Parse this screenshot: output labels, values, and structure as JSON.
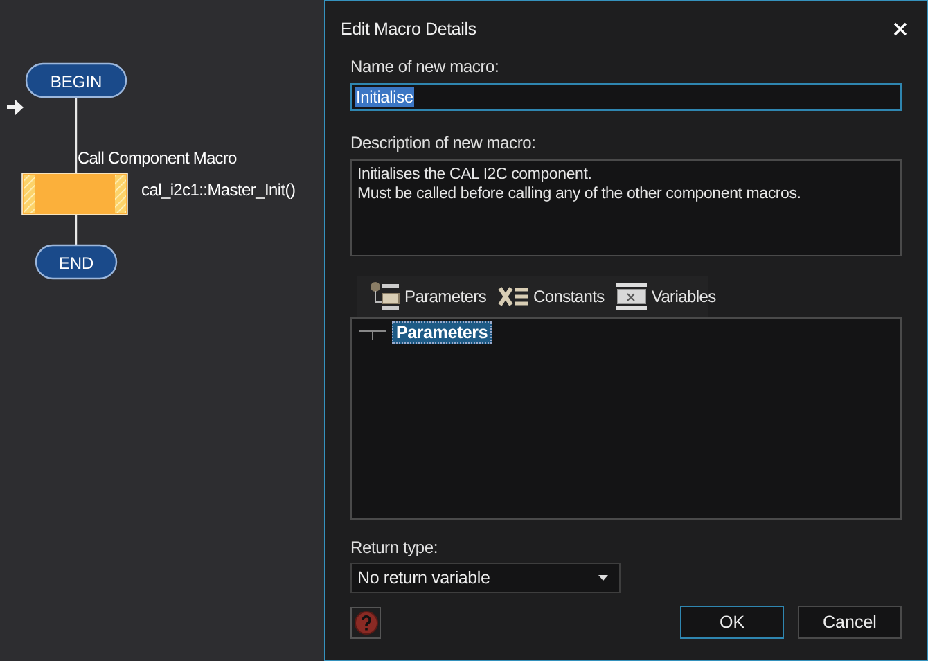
{
  "flowchart": {
    "nodes": [
      {
        "kind": "terminal",
        "label": "BEGIN"
      },
      {
        "kind": "macro_call",
        "caption": "Call Component Macro",
        "label": "cal_i2c1::Master_Init()",
        "current": true
      },
      {
        "kind": "terminal",
        "label": "END"
      }
    ]
  },
  "dialog": {
    "title": "Edit Macro Details",
    "name_label": "Name of new macro:",
    "name_value": "Initialise",
    "description_label": "Description of new macro:",
    "description_value": "Initialises the CAL I2C component.\nMust be called before calling any of the other component macros.",
    "tabs": [
      {
        "kind": "parameters",
        "label": "Parameters"
      },
      {
        "kind": "constants",
        "label": "Constants"
      },
      {
        "kind": "variables",
        "label": "Variables"
      }
    ],
    "tree": [
      {
        "label": "Parameters",
        "selected": true
      }
    ],
    "return_type_label": "Return type:",
    "return_type_value": "No return variable",
    "buttons": [
      {
        "label": "OK",
        "default": true
      },
      {
        "label": "Cancel",
        "default": false
      }
    ]
  }
}
